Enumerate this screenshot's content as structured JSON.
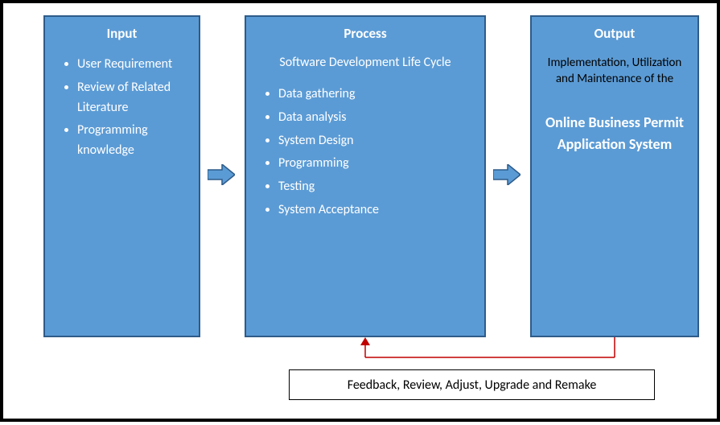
{
  "input": {
    "title": "Input",
    "items": [
      "User Requirement",
      "Review of Related Literature",
      "Programming knowledge"
    ]
  },
  "process": {
    "title": "Process",
    "subtitle": "Software Development Life Cycle",
    "items": [
      "Data gathering",
      "Data analysis",
      "System Design",
      "Programming",
      "Testing",
      "System Acceptance"
    ]
  },
  "output": {
    "title": "Output",
    "top_text": "Implementation, Utilization and Maintenance of the",
    "main_text": "Online Business Permit Application System"
  },
  "feedback": {
    "label": "Feedback, Review, Adjust, Upgrade and Remake"
  }
}
